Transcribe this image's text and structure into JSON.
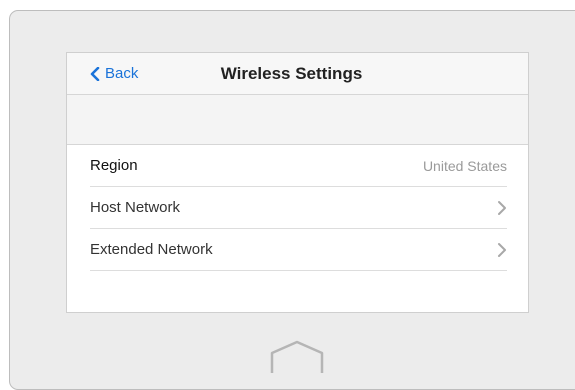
{
  "header": {
    "back_label": "Back",
    "title": "Wireless Settings"
  },
  "rows": [
    {
      "label": "Region",
      "value": "United States"
    },
    {
      "label": "Host Network"
    },
    {
      "label": "Extended Network"
    }
  ],
  "icons": {
    "back": "chevron-left-icon",
    "row_nav": "chevron-right-icon",
    "home": "home-icon"
  },
  "colors": {
    "accent": "#1a73d9",
    "device_frame": "#ececec"
  }
}
